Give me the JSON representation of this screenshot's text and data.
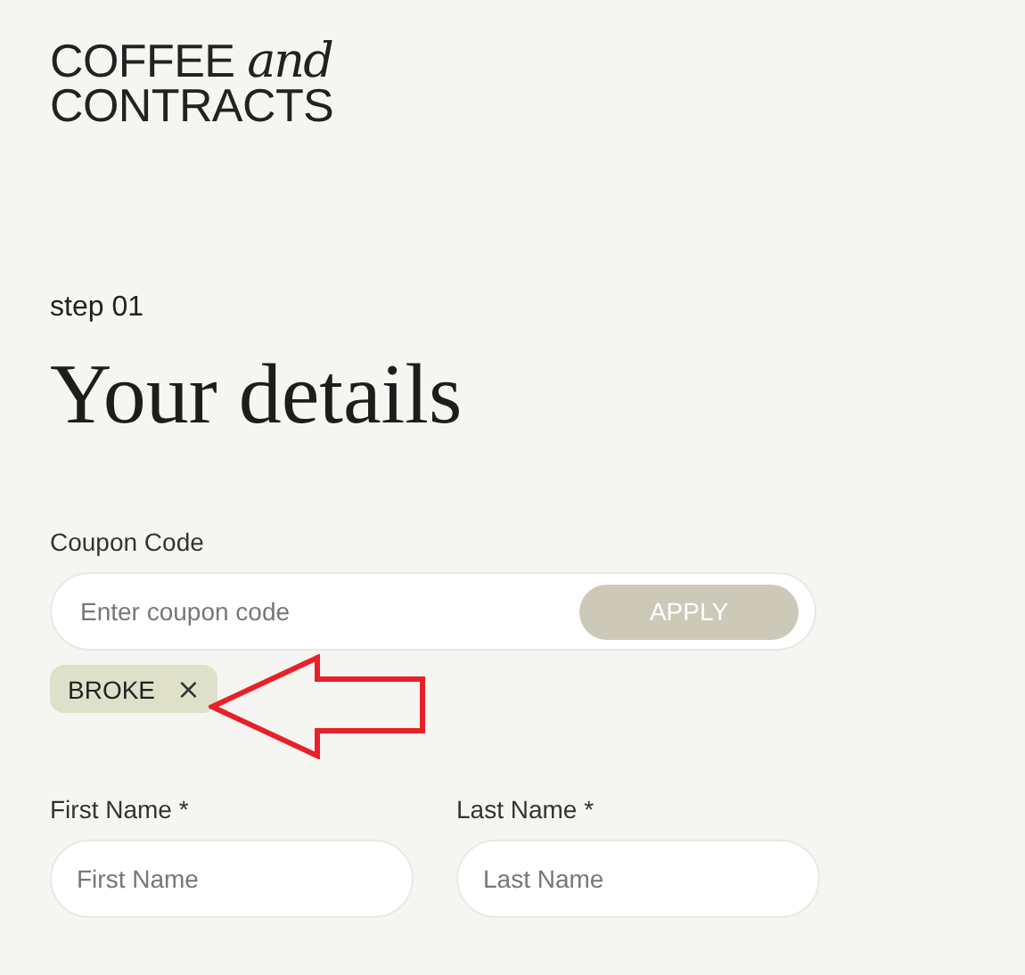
{
  "logo": {
    "lines": [
      "COFFEE *and*",
      "CONTRACTS"
    ]
  },
  "step": "step 01",
  "title": "Your details",
  "coupon": {
    "label": "Coupon Code",
    "placeholder": "Enter coupon code",
    "button": "APPLY",
    "applied": [
      {
        "code": "BROKE",
        "remove": "×"
      }
    ]
  },
  "fields": [
    {
      "label": "First Name *",
      "placeholder": "First Name"
    },
    {
      "label": "Last Name *",
      "placeholder": "Last Name"
    }
  ]
}
